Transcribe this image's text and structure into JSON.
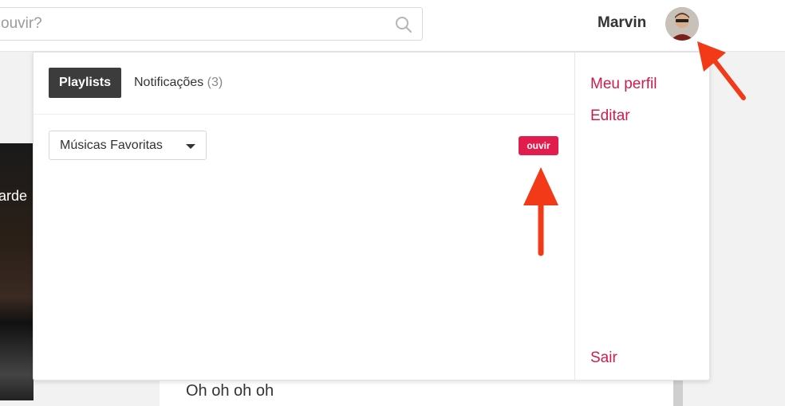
{
  "header": {
    "search_placeholder": "ouvir?",
    "username": "Marvin"
  },
  "background": {
    "side_text": "arde",
    "lyrics_line": "Oh oh oh oh"
  },
  "dropdown": {
    "tabs": {
      "active_label": "Playlists",
      "notifications_label": "Notificações",
      "notifications_count": "(3)"
    },
    "playlist_select_value": "Músicas Favoritas",
    "play_button_label": "ouvir",
    "menu": {
      "profile": "Meu perfil",
      "edit": "Editar",
      "logout": "Sair"
    }
  },
  "colors": {
    "accent": "#e21d4e",
    "link": "#cf1b4b",
    "annotation_arrow": "#f23a18"
  },
  "icons": {
    "search": "search-icon",
    "avatar": "user-avatar",
    "caret": "chevron-down-icon"
  }
}
